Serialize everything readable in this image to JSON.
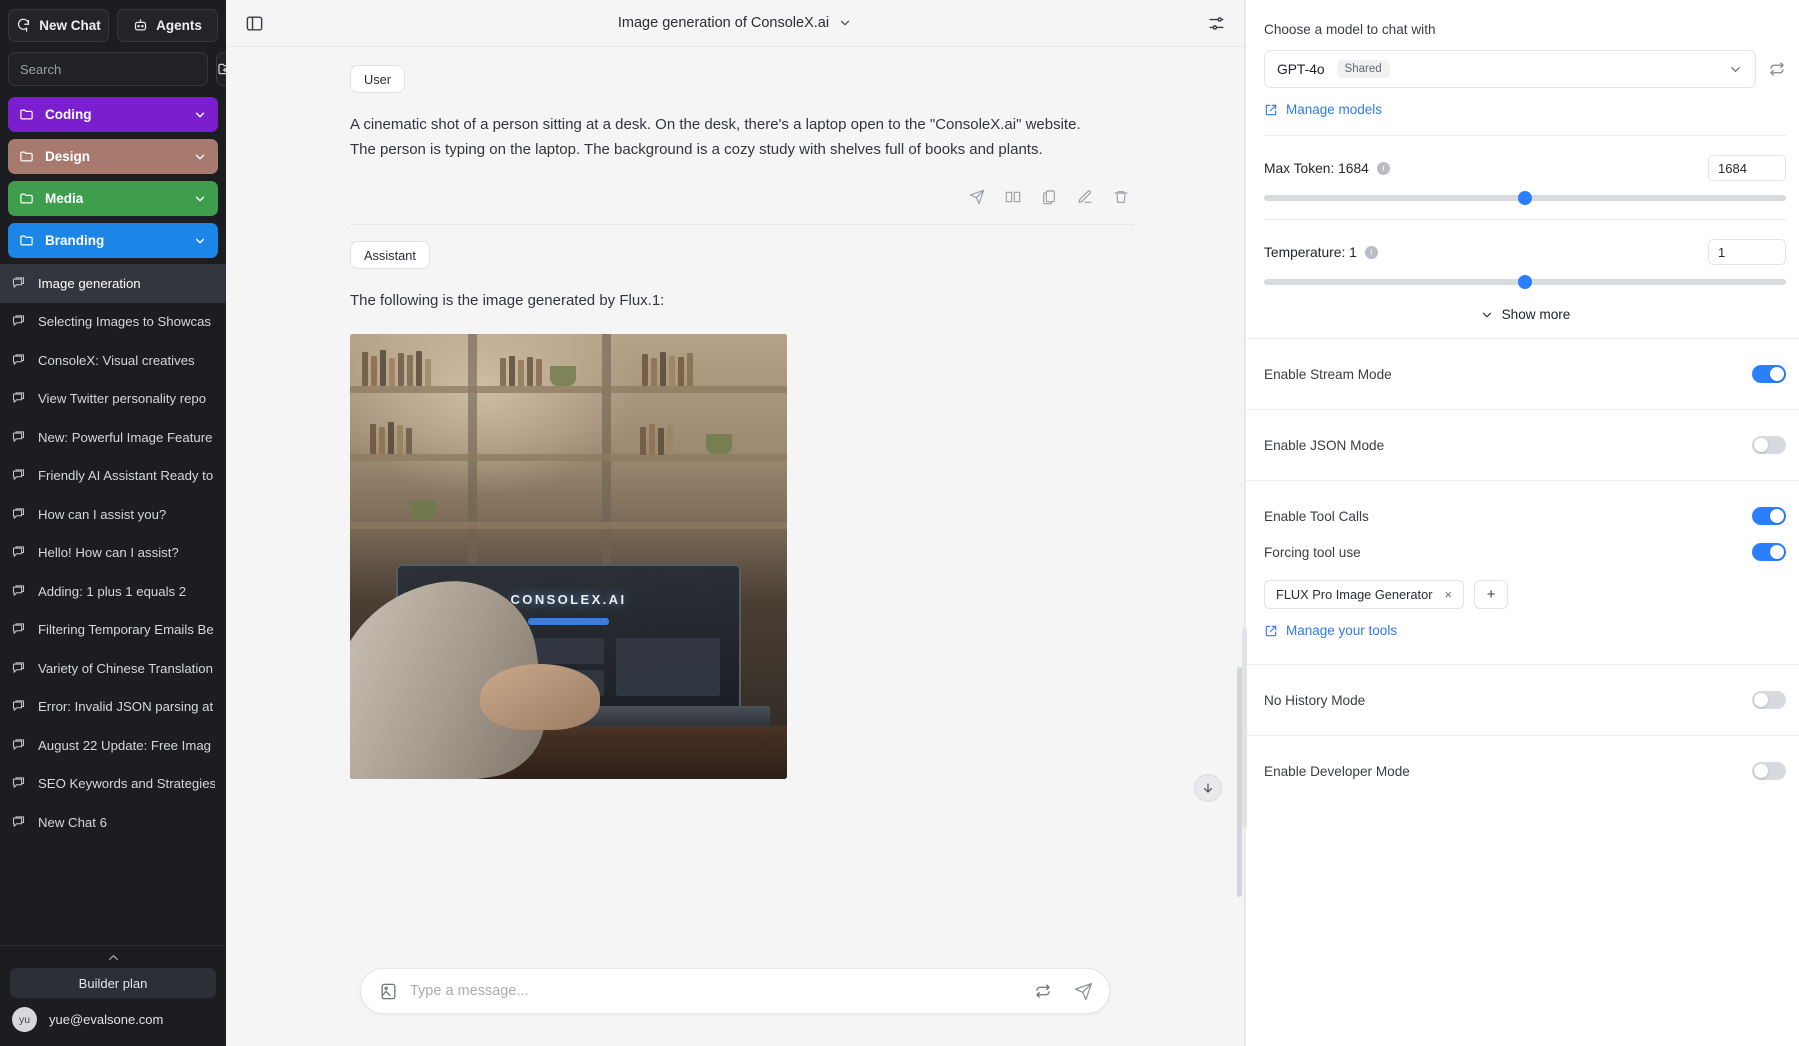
{
  "sidebar": {
    "new_chat_label": "New Chat",
    "agents_label": "Agents",
    "search_placeholder": "Search",
    "folders": [
      {
        "label": "Coding",
        "color": "#7b1fce"
      },
      {
        "label": "Design",
        "color": "#a8796e"
      },
      {
        "label": "Media",
        "color": "#3f9e4d"
      },
      {
        "label": "Branding",
        "color": "#1b86e8"
      }
    ],
    "chats": [
      {
        "label": "Image generation",
        "selected": true
      },
      {
        "label": "Selecting Images to Showcas",
        "selected": false
      },
      {
        "label": "ConsoleX: Visual creatives",
        "selected": false
      },
      {
        "label": "View Twitter personality repo",
        "selected": false
      },
      {
        "label": "New: Powerful Image Feature",
        "selected": false
      },
      {
        "label": "Friendly AI Assistant Ready to",
        "selected": false
      },
      {
        "label": "How can I assist you?",
        "selected": false
      },
      {
        "label": "Hello! How can I assist?",
        "selected": false
      },
      {
        "label": "Adding: 1 plus 1 equals 2",
        "selected": false
      },
      {
        "label": "Filtering Temporary Emails Be",
        "selected": false
      },
      {
        "label": "Variety of Chinese Translation",
        "selected": false
      },
      {
        "label": "Error: Invalid JSON parsing at",
        "selected": false
      },
      {
        "label": "August 22 Update: Free Imag",
        "selected": false
      },
      {
        "label": "SEO Keywords and Strategies",
        "selected": false
      },
      {
        "label": "New Chat 6",
        "selected": false
      }
    ],
    "plan_label": "Builder plan",
    "user_initials": "yu",
    "user_email": "yue@evalsone.com"
  },
  "main": {
    "chat_title": "Image generation of ConsoleX.ai",
    "messages": [
      {
        "role": "User",
        "text": "A cinematic shot of a person sitting at a desk. On the desk, there's a laptop open to the \"ConsoleX.ai\" website. The person is typing on the laptop. The background is a cozy study with shelves full of books and plants."
      },
      {
        "role": "Assistant",
        "text": "The following is the image generated by Flux.1:",
        "image_brand_text": "CONSOLEX.AI"
      }
    ],
    "composer_placeholder": "Type a message..."
  },
  "settings": {
    "model_heading": "Choose a model to chat with",
    "model_name": "GPT-4o",
    "model_badge": "Shared",
    "manage_models_label": "Manage models",
    "max_token": {
      "label": "Max Token: 1684",
      "value": "1684",
      "slider_percent": 50
    },
    "temperature": {
      "label": "Temperature: 1",
      "value": "1",
      "slider_percent": 50
    },
    "show_more_label": "Show more",
    "toggles": [
      {
        "label": "Enable Stream Mode",
        "on": true
      },
      {
        "label": "Enable JSON Mode",
        "on": false
      },
      {
        "label": "Enable Tool Calls",
        "on": true
      },
      {
        "label": "Forcing tool use",
        "on": true
      },
      {
        "label": "No History Mode",
        "on": false
      },
      {
        "label": "Enable Developer Mode",
        "on": false
      }
    ],
    "tool_chip_label": "FLUX Pro Image Generator",
    "tool_chip_remove": "×",
    "tool_add_label": "+",
    "manage_tools_label": "Manage your tools",
    "accent_color": "#2b7fff",
    "link_color": "#2f7ae5"
  }
}
